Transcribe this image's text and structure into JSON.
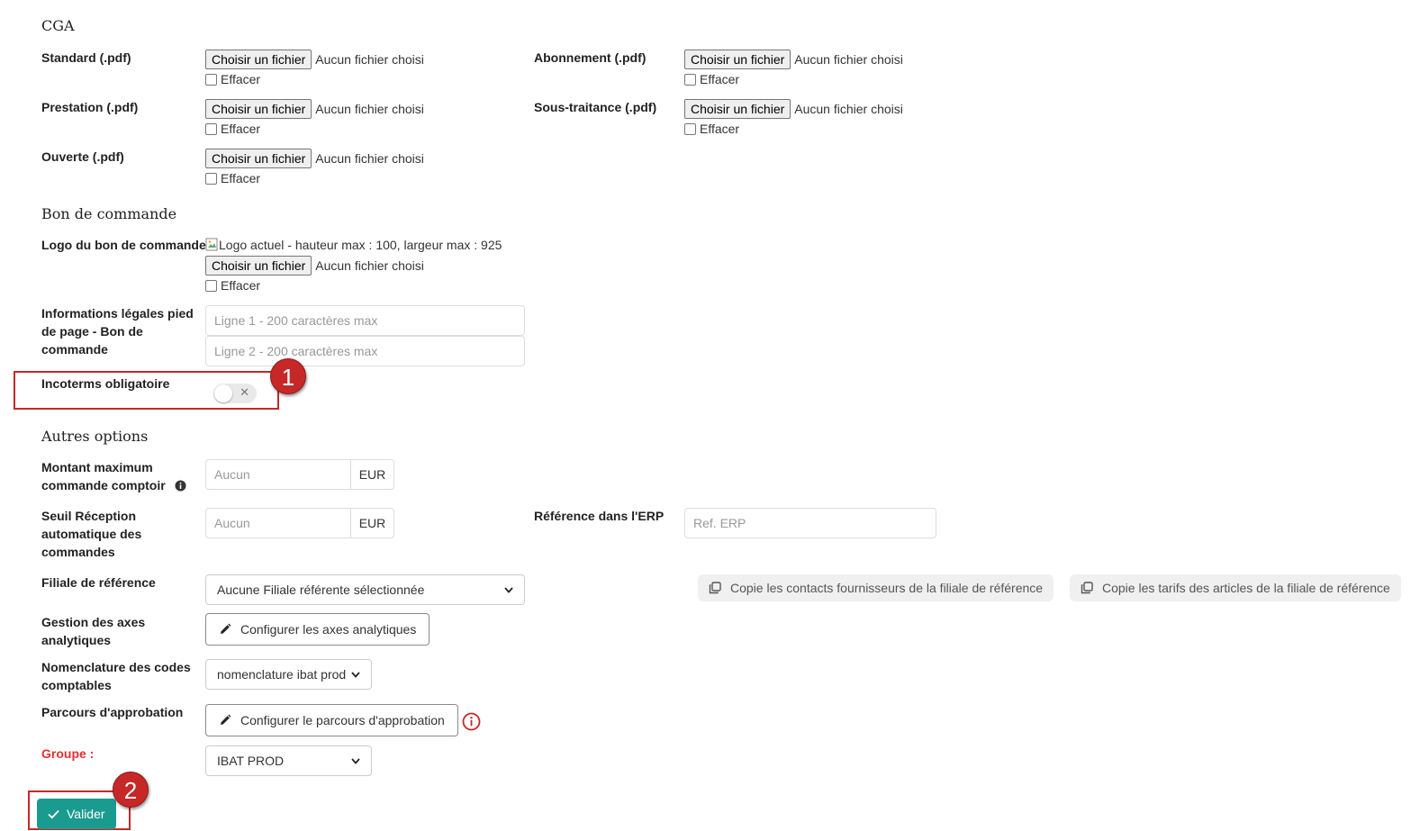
{
  "sections": {
    "cga": "CGA",
    "bon_commande": "Bon de commande",
    "autres_options": "Autres options"
  },
  "file_widget": {
    "button_label": "Choisir un fichier",
    "status": "Aucun fichier choisi",
    "clear_label": "Effacer"
  },
  "cga_fields": {
    "standard": "Standard (.pdf)",
    "abonnement": "Abonnement (.pdf)",
    "prestation": "Prestation (.pdf)",
    "sous_traitance": "Sous-traitance (.pdf)",
    "ouverte": "Ouverte (.pdf)"
  },
  "bon_commande": {
    "logo_label": "Logo du bon de commande",
    "logo_alt": "Logo actuel - hauteur max : 100, largeur max : 925",
    "legal_label": "Informations légales pied de page - Bon de commande",
    "line1_placeholder": "Ligne 1 - 200 caractères max",
    "line2_placeholder": "Ligne 2 - 200 caractères max",
    "incoterms_label": "Incoterms obligatoire",
    "incoterms_enabled": false
  },
  "autres": {
    "montant_label": "Montant maximum commande comptoir",
    "montant_placeholder": "Aucun",
    "currency": "EUR",
    "seuil_label": "Seuil Réception automatique des commandes",
    "seuil_placeholder": "Aucun",
    "erp_label": "Référence dans l'ERP",
    "erp_placeholder": "Ref. ERP",
    "filiale_label": "Filiale de référence",
    "filiale_value": "Aucune Filiale référente sélectionnée",
    "copy_contacts": "Copie les contacts fournisseurs de la filiale de référence",
    "copy_tarifs": "Copie les tarifs des articles de la filiale de référence",
    "axes_label": "Gestion des axes analytiques",
    "axes_button": "Configurer les axes analytiques",
    "nomenclature_label": "Nomenclature des codes comptables",
    "nomenclature_value": "nomenclature ibat prod",
    "parcours_label": "Parcours d'approbation",
    "parcours_button": "Configurer le parcours d'approbation",
    "groupe_label": "Groupe :",
    "groupe_value": "IBAT PROD"
  },
  "submit_label": "Valider",
  "annotations": [
    "1",
    "2"
  ],
  "colors": {
    "annotation": "#c62828",
    "submit": "#1a9b8f",
    "required_label": "#e03131",
    "warning_icon": "#c62828"
  },
  "icons": {
    "info": "info-icon",
    "pencil": "pencil-icon",
    "copy": "copy-icon",
    "check": "check-icon",
    "warning": "alert-circle-icon",
    "chevron": "chevron-down-icon"
  }
}
